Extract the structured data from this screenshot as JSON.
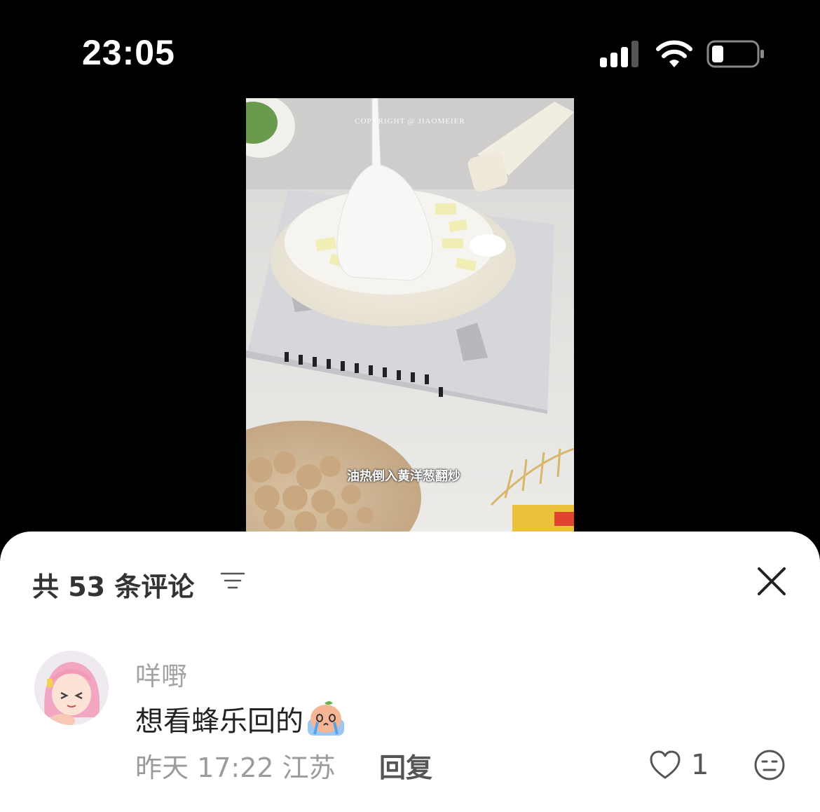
{
  "status_bar": {
    "time": "23:05"
  },
  "video": {
    "watermark": "COPYRIGHT @ JIAOMEIER",
    "subtitle": "油热倒入黄洋葱翻炒"
  },
  "comments_sheet": {
    "title": "共 53 条评论",
    "comment": {
      "username": "咩嘢",
      "text": "想看蜂乐回的",
      "meta": "昨天 17:22 江苏",
      "reply_label": "回复",
      "like_count": "1"
    }
  }
}
